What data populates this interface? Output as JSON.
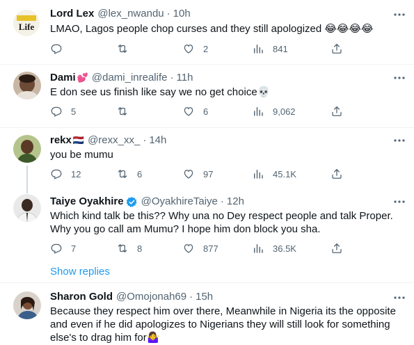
{
  "tweets": [
    {
      "name": "Lord Lex",
      "name_emoji": "",
      "handle": "@lex_nwandu",
      "time": "10h",
      "text": "LMAO, Lagos people chop curses and they still apologized 😂😂😂😂",
      "avatar": "logo-life",
      "actions": {
        "replies": "",
        "retweets": "",
        "likes": "2",
        "views": "841"
      }
    },
    {
      "name": "Dami",
      "name_emoji": "💕",
      "handle": "@dami_inrealife",
      "time": "11h",
      "text": "E don see us finish like say we no get choice💀",
      "avatar": "photo-person",
      "actions": {
        "replies": "5",
        "retweets": "",
        "likes": "6",
        "views": "9,062"
      }
    },
    {
      "name": "rekx",
      "name_emoji": "🇳🇱",
      "handle": "@rexx_xx_",
      "time": "14h",
      "text": "you be mumu",
      "avatar": "photo-person",
      "actions": {
        "replies": "12",
        "retweets": "6",
        "likes": "97",
        "views": "45.1K"
      }
    },
    {
      "name": "Taiye Oyakhire",
      "name_emoji": "",
      "verified": true,
      "handle": "@OyakhireTaiye",
      "time": "12h",
      "text": "Which kind talk be this?? Why una no Dey respect people and talk Proper. Why you go call am Mumu? I hope him don block you sha.",
      "avatar": "photo-person",
      "actions": {
        "replies": "7",
        "retweets": "8",
        "likes": "877",
        "views": "36.5K"
      }
    },
    {
      "name": "Sharon Gold",
      "name_emoji": "",
      "handle": "@Omojonah69",
      "time": "15h",
      "text": "Because they respect him over there, Meanwhile in Nigeria its the opposite and even if he did apologizes to Nigerians they will still look for something else's to drag him for🤷‍♀️",
      "avatar": "photo-person"
    }
  ],
  "show_replies_label": "Show replies",
  "colors": {
    "accent": "#1d9bf0",
    "muted": "#536471",
    "text": "#0f1419",
    "divider": "#eff3f4"
  },
  "icons": {
    "reply": "reply-icon",
    "retweet": "retweet-icon",
    "like": "heart-icon",
    "views": "views-icon",
    "share": "share-icon",
    "more": "more-icon",
    "verified": "verified-badge-icon"
  }
}
